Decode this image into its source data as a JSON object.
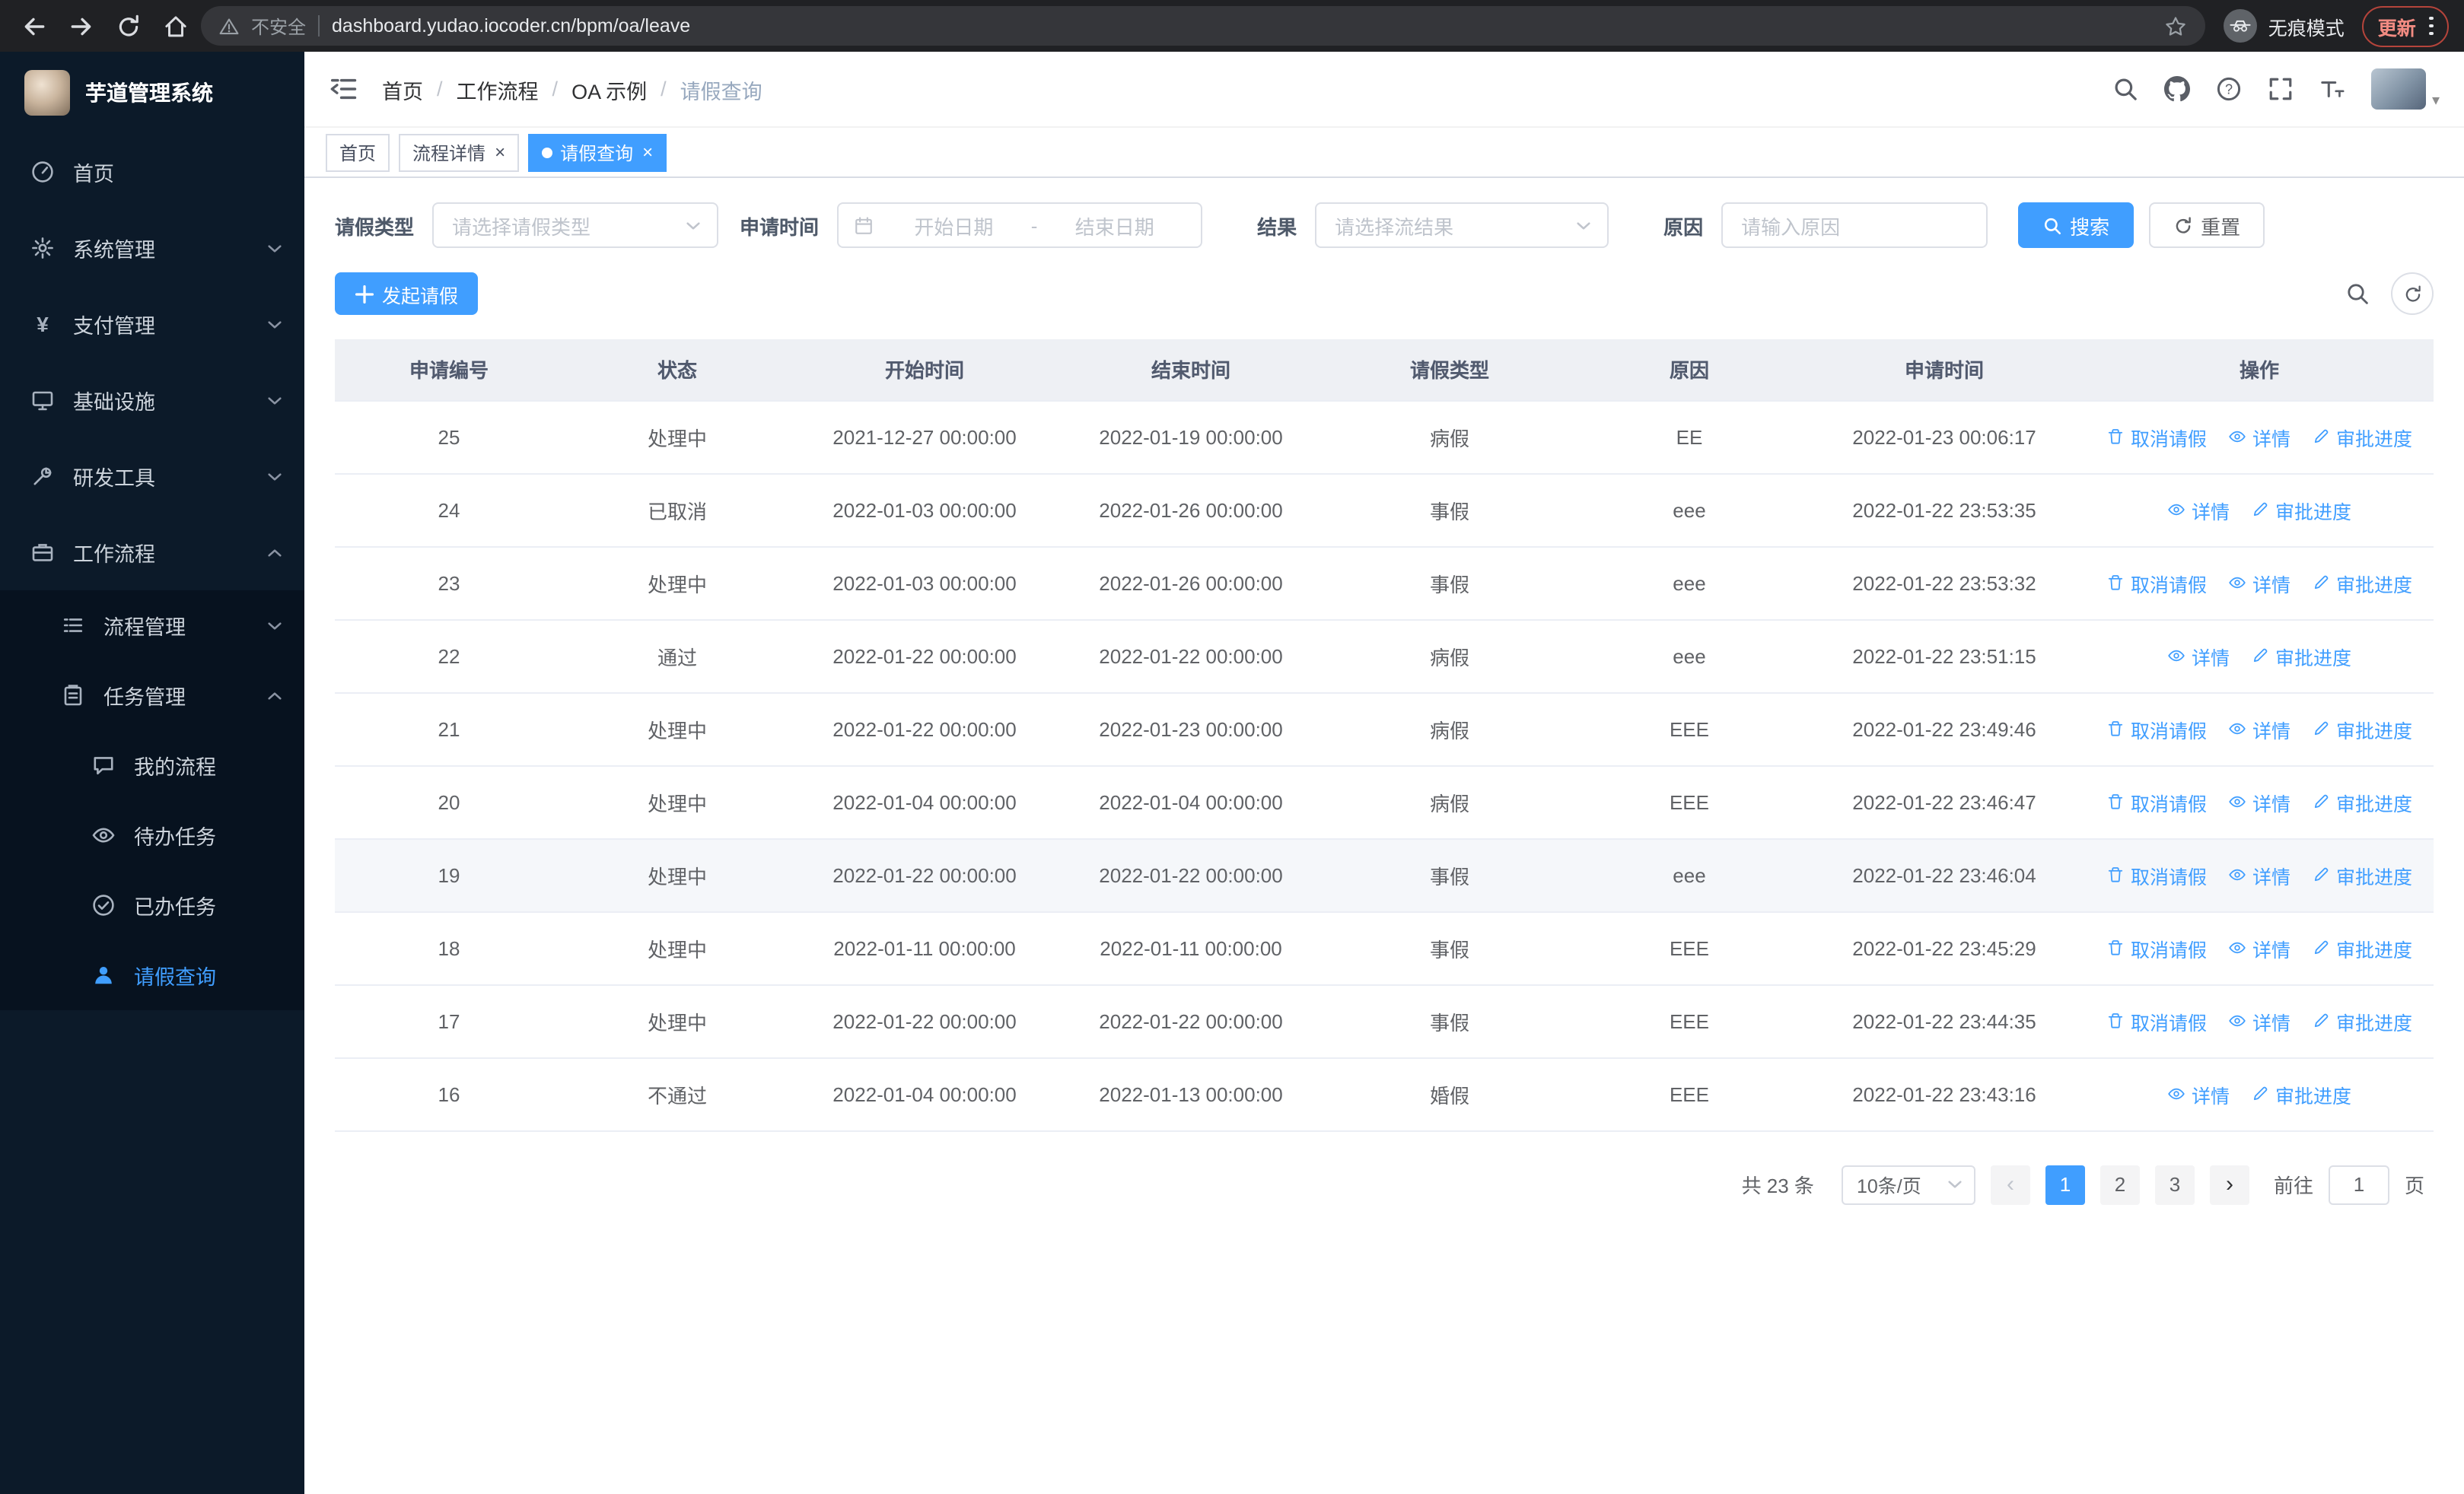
{
  "browser": {
    "security_warning": "不安全",
    "url": "dashboard.yudao.iocoder.cn/bpm/oa/leave",
    "incognito_label": "无痕模式",
    "update_label": "更新"
  },
  "sidebar": {
    "logo_title": "芋道管理系统",
    "items": [
      {
        "label": "首页"
      },
      {
        "label": "系统管理"
      },
      {
        "label": "支付管理"
      },
      {
        "label": "基础设施"
      },
      {
        "label": "研发工具"
      },
      {
        "label": "工作流程"
      },
      {
        "label": "流程管理"
      },
      {
        "label": "任务管理"
      },
      {
        "label": "我的流程"
      },
      {
        "label": "待办任务"
      },
      {
        "label": "已办任务"
      },
      {
        "label": "请假查询"
      }
    ]
  },
  "header": {
    "breadcrumb": [
      "首页",
      "工作流程",
      "OA 示例",
      "请假查询"
    ]
  },
  "tabs": [
    {
      "label": "首页"
    },
    {
      "label": "流程详情"
    },
    {
      "label": "请假查询"
    }
  ],
  "filters": {
    "leave_type_label": "请假类型",
    "leave_type_placeholder": "请选择请假类型",
    "apply_time_label": "申请时间",
    "start_date_placeholder": "开始日期",
    "range_separator": "-",
    "end_date_placeholder": "结束日期",
    "result_label": "结果",
    "result_placeholder": "请选择流结果",
    "reason_label": "原因",
    "reason_placeholder": "请输入原因",
    "search_button": "搜索",
    "reset_button": "重置"
  },
  "toolbar": {
    "create_button": "发起请假"
  },
  "table": {
    "columns": [
      "申请编号",
      "状态",
      "开始时间",
      "结束时间",
      "请假类型",
      "原因",
      "申请时间",
      "操作"
    ],
    "actions": {
      "cancel": "取消请假",
      "detail": "详情",
      "progress": "审批进度"
    },
    "rows": [
      {
        "id": "25",
        "status": "处理中",
        "start": "2021-12-27 00:00:00",
        "end": "2022-01-19 00:00:00",
        "type": "病假",
        "reason": "EE",
        "applied": "2022-01-23 00:06:17",
        "cancelable": true,
        "highlighted": false
      },
      {
        "id": "24",
        "status": "已取消",
        "start": "2022-01-03 00:00:00",
        "end": "2022-01-26 00:00:00",
        "type": "事假",
        "reason": "eee",
        "applied": "2022-01-22 23:53:35",
        "cancelable": false,
        "highlighted": false
      },
      {
        "id": "23",
        "status": "处理中",
        "start": "2022-01-03 00:00:00",
        "end": "2022-01-26 00:00:00",
        "type": "事假",
        "reason": "eee",
        "applied": "2022-01-22 23:53:32",
        "cancelable": true,
        "highlighted": false
      },
      {
        "id": "22",
        "status": "通过",
        "start": "2022-01-22 00:00:00",
        "end": "2022-01-22 00:00:00",
        "type": "病假",
        "reason": "eee",
        "applied": "2022-01-22 23:51:15",
        "cancelable": false,
        "highlighted": false
      },
      {
        "id": "21",
        "status": "处理中",
        "start": "2022-01-22 00:00:00",
        "end": "2022-01-23 00:00:00",
        "type": "病假",
        "reason": "EEE",
        "applied": "2022-01-22 23:49:46",
        "cancelable": true,
        "highlighted": false
      },
      {
        "id": "20",
        "status": "处理中",
        "start": "2022-01-04 00:00:00",
        "end": "2022-01-04 00:00:00",
        "type": "病假",
        "reason": "EEE",
        "applied": "2022-01-22 23:46:47",
        "cancelable": true,
        "highlighted": false
      },
      {
        "id": "19",
        "status": "处理中",
        "start": "2022-01-22 00:00:00",
        "end": "2022-01-22 00:00:00",
        "type": "事假",
        "reason": "eee",
        "applied": "2022-01-22 23:46:04",
        "cancelable": true,
        "highlighted": true
      },
      {
        "id": "18",
        "status": "处理中",
        "start": "2022-01-11 00:00:00",
        "end": "2022-01-11 00:00:00",
        "type": "事假",
        "reason": "EEE",
        "applied": "2022-01-22 23:45:29",
        "cancelable": true,
        "highlighted": false
      },
      {
        "id": "17",
        "status": "处理中",
        "start": "2022-01-22 00:00:00",
        "end": "2022-01-22 00:00:00",
        "type": "事假",
        "reason": "EEE",
        "applied": "2022-01-22 23:44:35",
        "cancelable": true,
        "highlighted": false
      },
      {
        "id": "16",
        "status": "不通过",
        "start": "2022-01-04 00:00:00",
        "end": "2022-01-13 00:00:00",
        "type": "婚假",
        "reason": "EEE",
        "applied": "2022-01-22 23:43:16",
        "cancelable": false,
        "highlighted": false
      }
    ]
  },
  "pagination": {
    "total": "共 23 条",
    "page_size": "10条/页",
    "pages": [
      "1",
      "2",
      "3"
    ],
    "active_page": "1",
    "goto_label": "前往",
    "goto_value": "1",
    "goto_suffix": "页"
  },
  "colors": {
    "accent": "#409eff",
    "sidebar_bg": "#0c1a29",
    "submenu_bg": "#07121f",
    "link": "#409eff"
  }
}
